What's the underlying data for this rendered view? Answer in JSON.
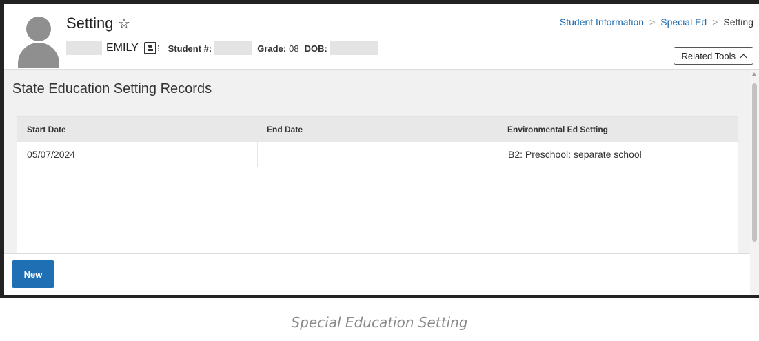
{
  "header": {
    "title": "Setting",
    "star_icon": "☆",
    "student_name": "EMILY",
    "card_dot": "⁝",
    "student_num_label": "Student #:",
    "grade_label": "Grade:",
    "grade_value": "08",
    "dob_label": "DOB:"
  },
  "breadcrumb": {
    "items": [
      "Student Information",
      "Special Ed",
      "Setting"
    ],
    "separator": ">"
  },
  "related_tools": {
    "label": "Related Tools"
  },
  "section": {
    "title": "State Education Setting Records"
  },
  "table": {
    "columns": [
      "Start Date",
      "End Date",
      "Environmental Ed Setting"
    ],
    "rows": [
      [
        "05/07/2024",
        "",
        "B2: Preschool: separate school"
      ]
    ]
  },
  "footer": {
    "new_label": "New"
  },
  "caption": "Special Education Setting",
  "colors": {
    "accent": "#1f6fb5",
    "link": "#1a6bb0"
  }
}
